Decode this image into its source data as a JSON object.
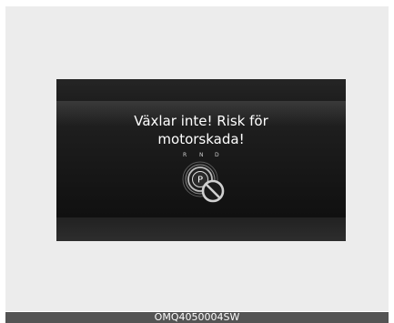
{
  "display": {
    "message_line1": "Växlar inte! Risk för",
    "message_line2": "motorskada!",
    "gears": [
      "R",
      "N",
      "D"
    ],
    "current_gear": "P",
    "icons": {
      "gear_selector": "gear-selector-icon",
      "prohibited": "prohibited-icon"
    }
  },
  "footer": {
    "code": "OMQ4050004SW"
  },
  "colors": {
    "display_background": "#1b1b1b",
    "text": "#ffffff",
    "footer_bar": "#545454"
  }
}
